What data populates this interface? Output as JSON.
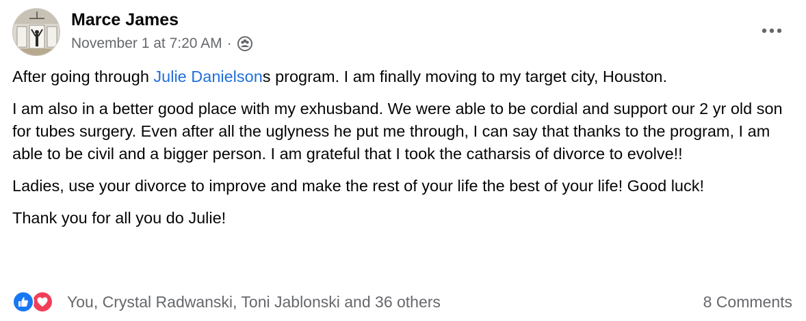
{
  "post": {
    "author": "Marce James",
    "timestamp": "November 1 at 7:20 AM",
    "separator": "·",
    "audience_icon": "friends-icon",
    "more_icon": "more-options-icon",
    "paragraph1": {
      "before": "After going through ",
      "link": "Julie Danielson",
      "after": "s program. I am finally moving to my target city, Houston."
    },
    "paragraph2": "I am also in a better good place with my exhusband. We were able to be cordial and support our 2 yr old son for tubes surgery. Even after all the uglyness he put me through, I can say that thanks to the program, I am able to be civil and a bigger person. I am grateful that I took the catharsis of divorce to evolve!!",
    "paragraph3": "Ladies, use your divorce to improve and make the rest of your life the best of your life! Good luck!",
    "paragraph4": "Thank you for all you do Julie!"
  },
  "footer": {
    "reaction_icons": [
      "like-icon",
      "love-icon"
    ],
    "reactions_text": "You, Crystal Radwanski, Toni Jablonski and 36 others",
    "comments_text": "8 Comments"
  },
  "colors": {
    "link": "#216fdb",
    "secondary_text": "#65676b",
    "like": "#1877f2",
    "love": "#f33e58"
  }
}
